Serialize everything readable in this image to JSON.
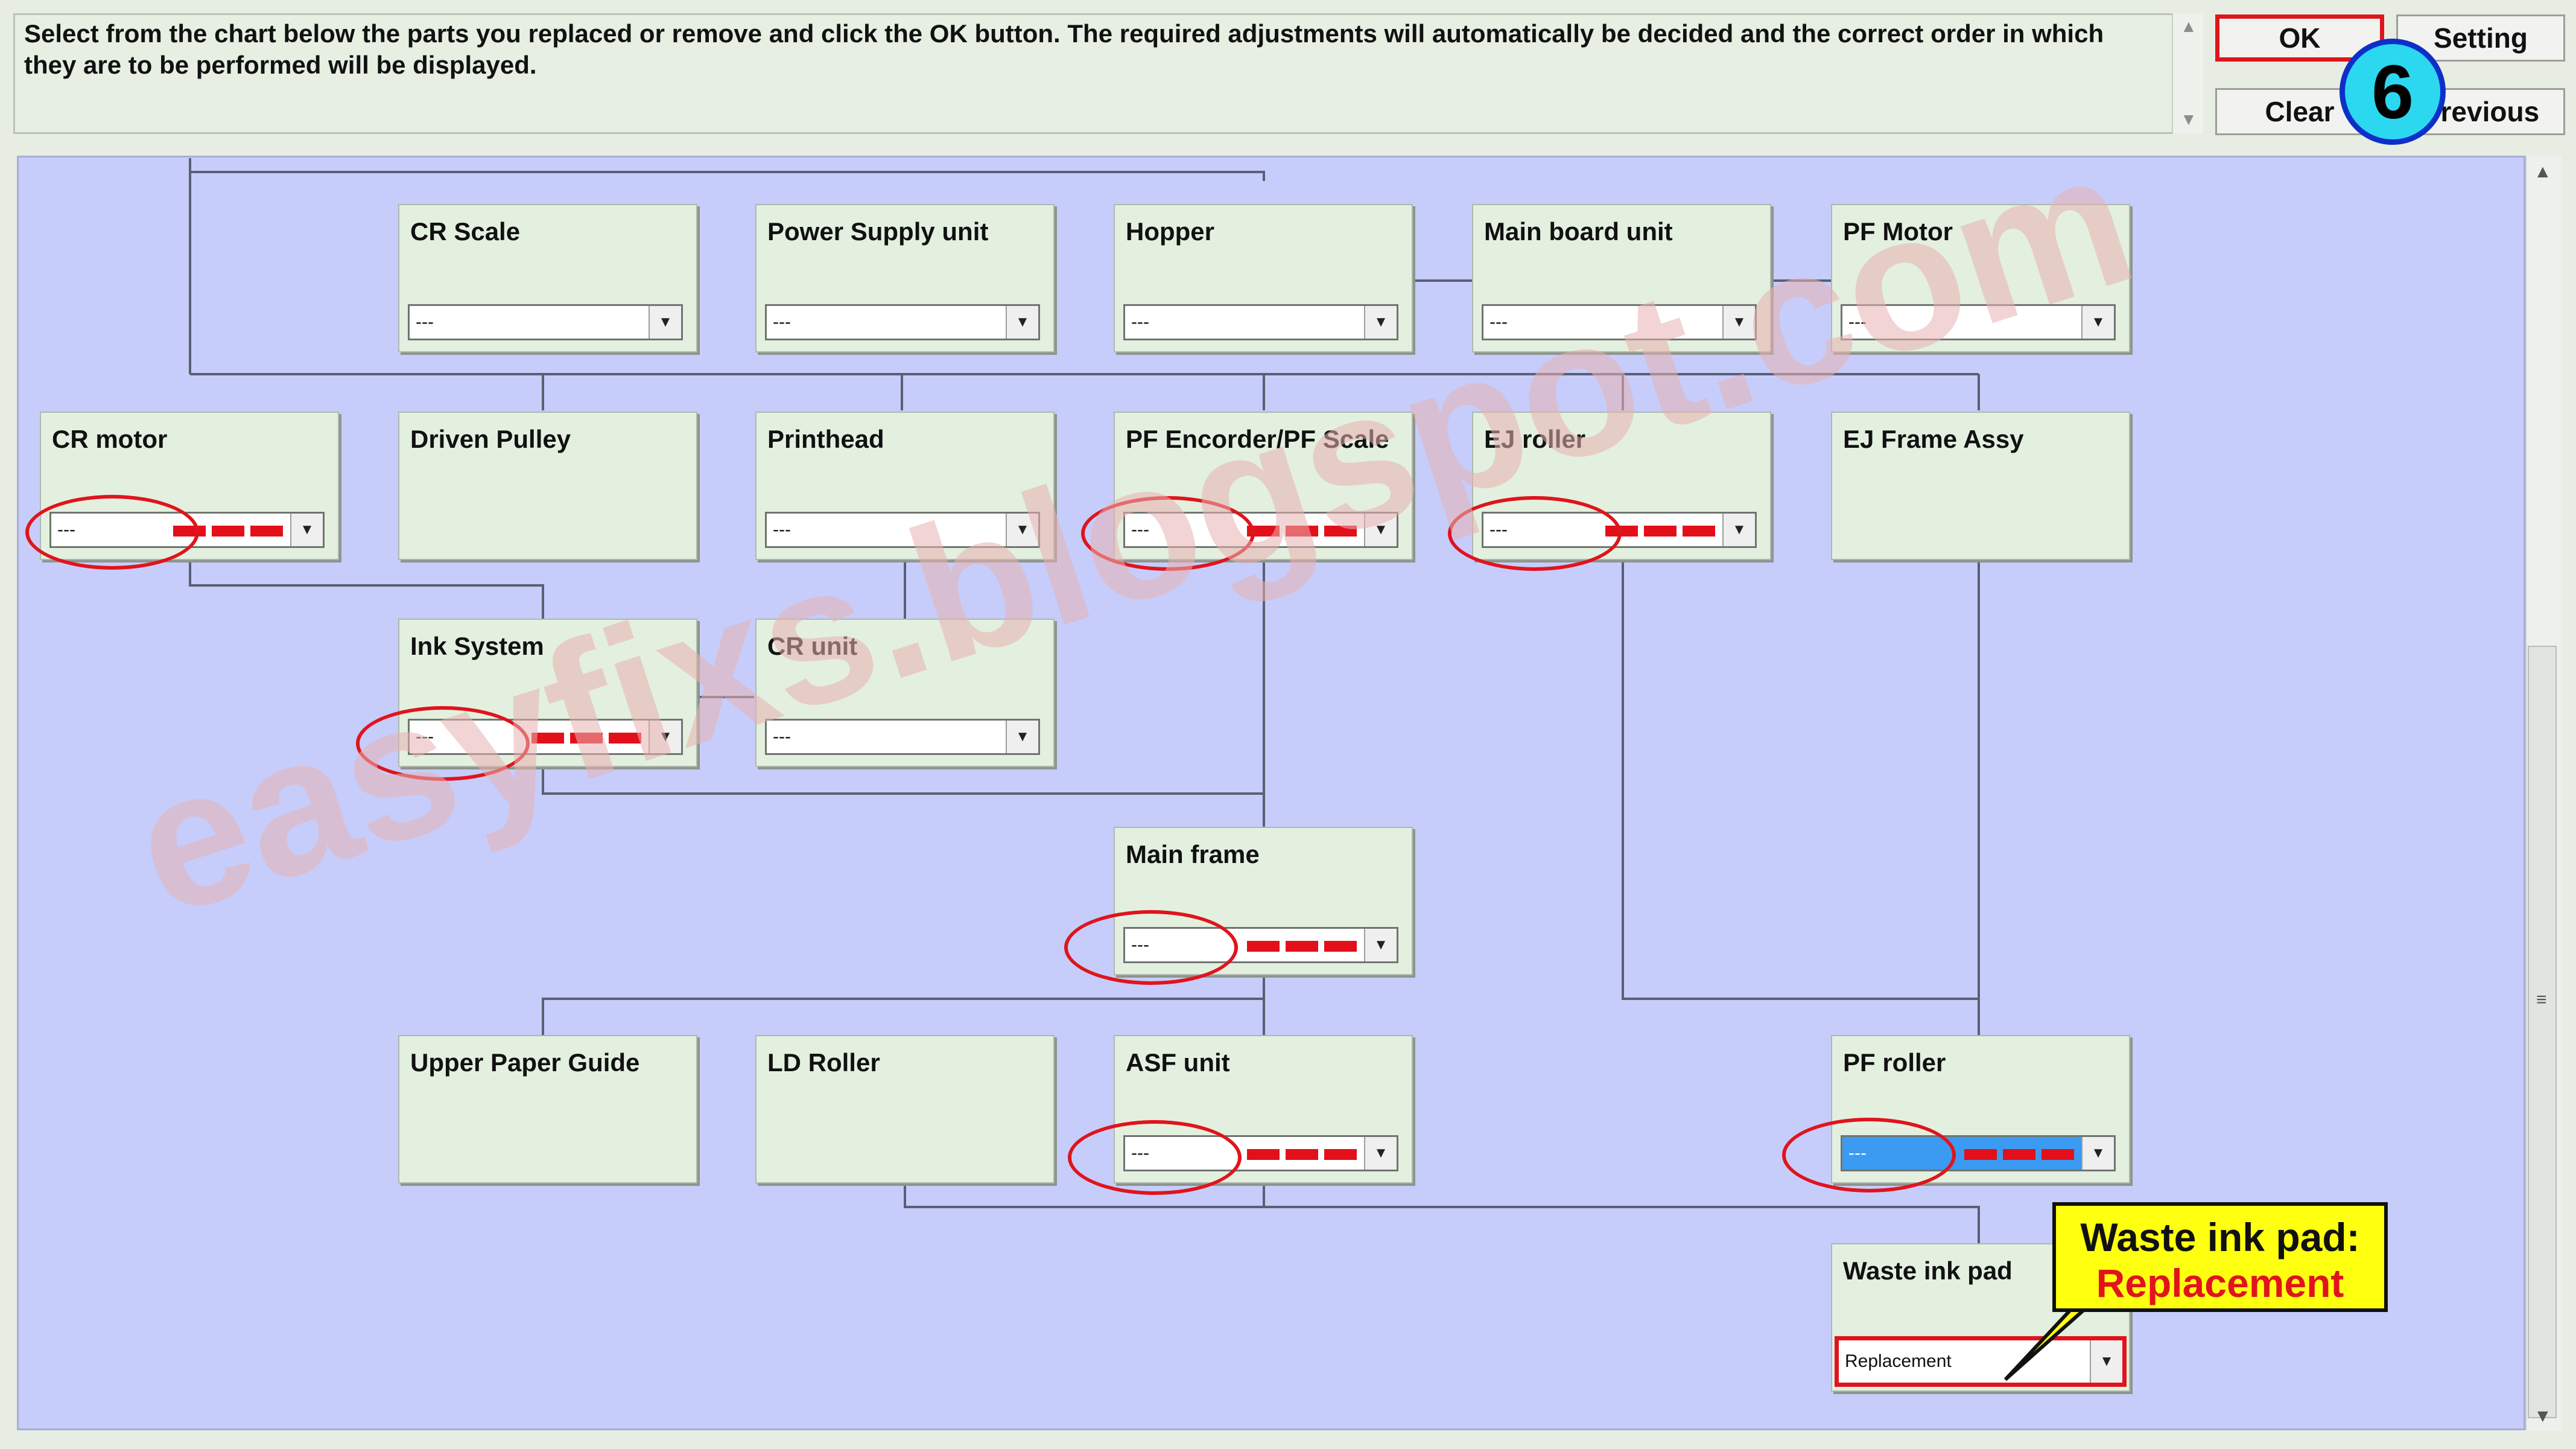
{
  "instructions": "Select from the chart below the parts you replaced or remove and click the OK button. The required adjustments will automatically be decided and the correct order in which they are to be performed will be displayed.",
  "buttons": {
    "ok": "OK",
    "setting": "Setting",
    "clear": "Clear",
    "previous": "Previous"
  },
  "step_badge": "6",
  "parts": {
    "cr_scale": {
      "label": "CR Scale",
      "value": "---"
    },
    "power_supply": {
      "label": "Power Supply unit",
      "value": "---"
    },
    "hopper": {
      "label": "Hopper",
      "value": "---"
    },
    "main_board": {
      "label": "Main board unit",
      "value": "---"
    },
    "pf_motor": {
      "label": "PF Motor",
      "value": "---"
    },
    "cr_motor": {
      "label": "CR motor",
      "value": "---"
    },
    "driven_pulley": {
      "label": "Driven Pulley"
    },
    "printhead": {
      "label": "Printhead",
      "value": "---"
    },
    "pf_encoder": {
      "label": "PF Encorder/PF Scale",
      "value": "---"
    },
    "ej_roller": {
      "label": "EJ roller",
      "value": "---"
    },
    "ej_frame": {
      "label": "EJ Frame Assy"
    },
    "ink_system": {
      "label": "Ink System",
      "value": "---"
    },
    "cr_unit": {
      "label": "CR unit",
      "value": "---"
    },
    "main_frame": {
      "label": "Main frame",
      "value": "---"
    },
    "upper_paper_guide": {
      "label": "Upper Paper Guide"
    },
    "ld_roller": {
      "label": "LD Roller"
    },
    "asf_unit": {
      "label": "ASF unit",
      "value": "---"
    },
    "pf_roller": {
      "label": "PF roller",
      "value": "---"
    },
    "waste_ink_pad": {
      "label": "Waste ink pad",
      "value": "Replacement"
    }
  },
  "callout": {
    "line1": "Waste ink pad:",
    "line2": "Replacement"
  },
  "watermark": "easyfixs.blogspot.com",
  "colors": {
    "chart_bg": "#c6cdfb",
    "part_bg": "#e3f0e0",
    "highlight_red": "#e0141c",
    "callout_yellow": "#ffff10",
    "badge_cyan": "#2bd8f0"
  }
}
